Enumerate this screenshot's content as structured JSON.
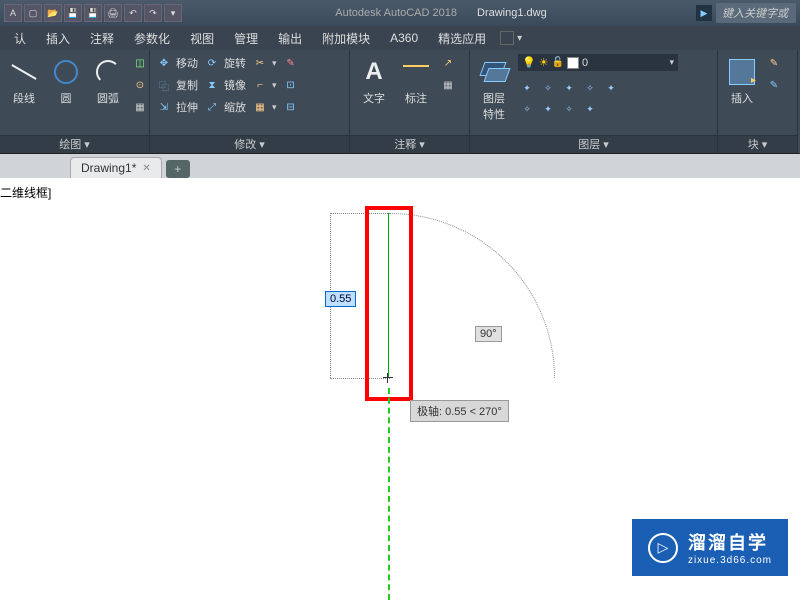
{
  "title": {
    "app": "Autodesk AutoCAD 2018",
    "doc": "Drawing1.dwg"
  },
  "qat_icons": [
    "acad-logo",
    "new",
    "open",
    "save",
    "saveas",
    "plot",
    "undo",
    "redo"
  ],
  "search_placeholder": "键入关键字或",
  "menu": [
    "认",
    "插入",
    "注释",
    "参数化",
    "视图",
    "管理",
    "输出",
    "附加模块",
    "A360",
    "精选应用"
  ],
  "tabs": {
    "active": "Drawing1*",
    "add": "+"
  },
  "viewport_label": "二维线框]",
  "ribbon": {
    "draw": {
      "title": "绘图 ▾",
      "items": {
        "polyline": "段线",
        "circle": "圆",
        "arc": "圆弧"
      }
    },
    "modify": {
      "title": "修改 ▾",
      "rows": [
        {
          "icon": "move-icon",
          "label": "移动",
          "extra1": "rotate-icon",
          "extra1_label": "旋转",
          "extra2": "trim-icon"
        },
        {
          "icon": "copy-icon",
          "label": "复制",
          "extra1": "mirror-icon",
          "extra1_label": "镜像",
          "extra2": "fillet-icon"
        },
        {
          "icon": "stretch-icon",
          "label": "拉伸",
          "extra1": "scale-icon",
          "extra1_label": "缩放",
          "extra2": "array-icon"
        }
      ]
    },
    "annotate": {
      "title": "注释 ▾",
      "text": "文字",
      "dim": "标注"
    },
    "layers": {
      "title": "图层 ▾",
      "props": "图层\n特性",
      "current": "0"
    },
    "block": {
      "title": "块 ▾",
      "insert": "插入"
    }
  },
  "drawing": {
    "dim_value": "0.55",
    "angle_value": "90°",
    "polar_tip": "极轴: 0.55 < 270°"
  },
  "watermark": {
    "line1": "溜溜自学",
    "line2": "zixue.3d66.com"
  }
}
